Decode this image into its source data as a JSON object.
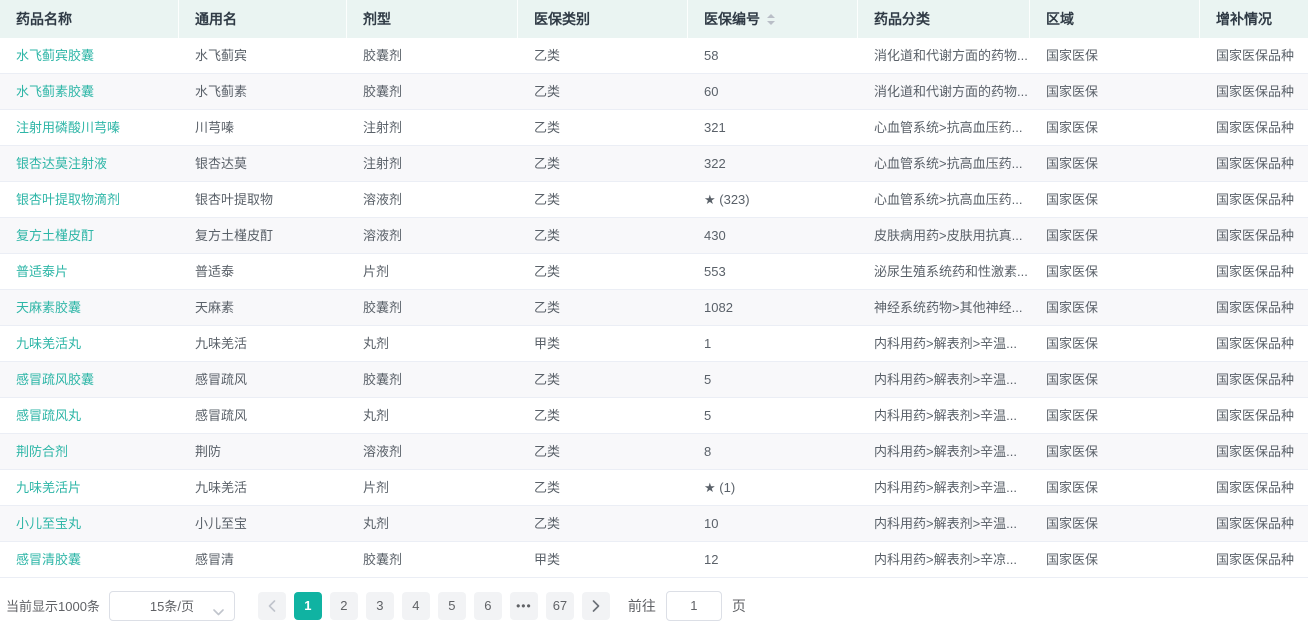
{
  "theme": {
    "accent": "#10b3a2",
    "link_color": "#2eb6a7",
    "header_bg": "#eaf4f2",
    "row_alt_bg": "#f8f8fa",
    "border_color": "#ebeef5",
    "text_color": "#5a6169",
    "header_text_color": "#2f3a45"
  },
  "table": {
    "columns": [
      {
        "key": "name",
        "label": "药品名称",
        "sortable": false
      },
      {
        "key": "generic-name",
        "label": "通用名",
        "sortable": false
      },
      {
        "key": "dosage-form",
        "label": "剂型",
        "sortable": false
      },
      {
        "key": "insurance-category",
        "label": "医保类别",
        "sortable": false
      },
      {
        "key": "insurance-number",
        "label": "医保编号",
        "sortable": true
      },
      {
        "key": "classification",
        "label": "药品分类",
        "sortable": false
      },
      {
        "key": "region",
        "label": "区域",
        "sortable": false
      },
      {
        "key": "supplement-status",
        "label": "增补情况",
        "sortable": false
      }
    ],
    "rows": [
      [
        "水飞蓟宾胶囊",
        "水飞蓟宾",
        "胶囊剂",
        "乙类",
        "58",
        "消化道和代谢方面的药物...",
        "国家医保",
        "国家医保品种"
      ],
      [
        "水飞蓟素胶囊",
        "水飞蓟素",
        "胶囊剂",
        "乙类",
        "60",
        "消化道和代谢方面的药物...",
        "国家医保",
        "国家医保品种"
      ],
      [
        "注射用磷酸川芎嗪",
        "川芎嗪",
        "注射剂",
        "乙类",
        "321",
        "心血管系统>抗高血压药...",
        "国家医保",
        "国家医保品种"
      ],
      [
        "银杏达莫注射液",
        "银杏达莫",
        "注射剂",
        "乙类",
        "322",
        "心血管系统>抗高血压药...",
        "国家医保",
        "国家医保品种"
      ],
      [
        "银杏叶提取物滴剂",
        "银杏叶提取物",
        "溶液剂",
        "乙类",
        "★ (323)",
        "心血管系统>抗高血压药...",
        "国家医保",
        "国家医保品种"
      ],
      [
        "复方土槿皮酊",
        "复方土槿皮酊",
        "溶液剂",
        "乙类",
        "430",
        "皮肤病用药>皮肤用抗真...",
        "国家医保",
        "国家医保品种"
      ],
      [
        "普适泰片",
        "普适泰",
        "片剂",
        "乙类",
        "553",
        "泌尿生殖系统药和性激素...",
        "国家医保",
        "国家医保品种"
      ],
      [
        "天麻素胶囊",
        "天麻素",
        "胶囊剂",
        "乙类",
        "1082",
        "神经系统药物>其他神经...",
        "国家医保",
        "国家医保品种"
      ],
      [
        "九味羌活丸",
        "九味羌活",
        "丸剂",
        "甲类",
        "1",
        "内科用药>解表剂>辛温...",
        "国家医保",
        "国家医保品种"
      ],
      [
        "感冒疏风胶囊",
        "感冒疏风",
        "胶囊剂",
        "乙类",
        "5",
        "内科用药>解表剂>辛温...",
        "国家医保",
        "国家医保品种"
      ],
      [
        "感冒疏风丸",
        "感冒疏风",
        "丸剂",
        "乙类",
        "5",
        "内科用药>解表剂>辛温...",
        "国家医保",
        "国家医保品种"
      ],
      [
        "荆防合剂",
        "荆防",
        "溶液剂",
        "乙类",
        "8",
        "内科用药>解表剂>辛温...",
        "国家医保",
        "国家医保品种"
      ],
      [
        "九味羌活片",
        "九味羌活",
        "片剂",
        "乙类",
        "★ (1)",
        "内科用药>解表剂>辛温...",
        "国家医保",
        "国家医保品种"
      ],
      [
        "小儿至宝丸",
        "小儿至宝",
        "丸剂",
        "乙类",
        "10",
        "内科用药>解表剂>辛温...",
        "国家医保",
        "国家医保品种"
      ],
      [
        "感冒清胶囊",
        "感冒清",
        "胶囊剂",
        "甲类",
        "12",
        "内科用药>解表剂>辛凉...",
        "国家医保",
        "国家医保品种"
      ]
    ]
  },
  "pagination": {
    "total_text": "当前显示1000条",
    "page_size_label": "15条/页",
    "pages": [
      "1",
      "2",
      "3",
      "4",
      "5",
      "6"
    ],
    "ellipsis": "•••",
    "last_page": "67",
    "active_page": "1",
    "goto_label": "前往",
    "goto_value": "1",
    "goto_suffix": "页"
  }
}
